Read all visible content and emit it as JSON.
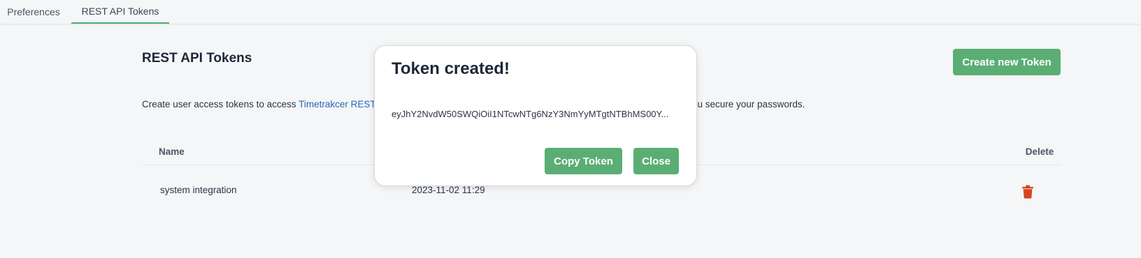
{
  "tabs": [
    {
      "label": "Preferences"
    },
    {
      "label": "REST API Tokens"
    }
  ],
  "page": {
    "title": "REST API Tokens",
    "create_button": "Create new Token",
    "description_prefix": "Create user access tokens to access ",
    "description_link": "Timetrakcer REST",
    "description_suffix": "ou secure your passwords."
  },
  "table": {
    "headers": {
      "name": "Name",
      "delete": "Delete"
    },
    "rows": [
      {
        "name": "system integration",
        "created": "2023-11-02 11:29"
      }
    ]
  },
  "modal": {
    "title": "Token created!",
    "token": "eyJhY2NvdW50SWQiOiI1NTcwNTg6NzY3NmYyMTgtNTBhMS00Y...",
    "copy_button": "Copy Token",
    "close_button": "Close"
  },
  "colors": {
    "accent_green": "#5aae74",
    "delete_red": "#d4471f",
    "link_blue": "#2a66b8"
  }
}
